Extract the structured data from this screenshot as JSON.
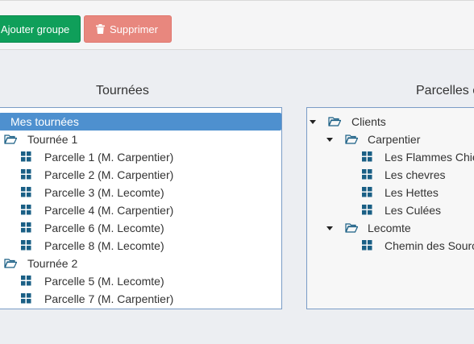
{
  "toolbar": {
    "add_group_label": "Ajouter groupe",
    "delete_label": "Supprimer"
  },
  "left_panel": {
    "title": "Tournées",
    "root_label": "Mes tournées",
    "groups": [
      {
        "label": "Tournée 1",
        "items": [
          "Parcelle 1 (M. Carpentier)",
          "Parcelle 2 (M. Carpentier)",
          "Parcelle 3 (M. Lecomte)",
          "Parcelle 4 (M. Carpentier)",
          "Parcelle 6 (M. Lecomte)",
          "Parcelle 8 (M. Lecomte)"
        ]
      },
      {
        "label": "Tournée 2",
        "items": [
          "Parcelle 5 (M. Lecomte)",
          "Parcelle 7 (M. Carpentier)"
        ]
      }
    ]
  },
  "right_panel": {
    "title": "Parcelles c",
    "root_label": "Clients",
    "clients": [
      {
        "label": "Carpentier",
        "items": [
          "Les Flammes Chie",
          "Les chevres",
          "Les Hettes",
          "Les Culées"
        ]
      },
      {
        "label": "Lecomte",
        "items": [
          "Chemin des Sourc"
        ]
      }
    ]
  },
  "colors": {
    "add_button": "#0f9f5a",
    "delete_button": "#e8877e",
    "selected_row": "#4e90cf",
    "tree_icon": "#1a5f85"
  }
}
